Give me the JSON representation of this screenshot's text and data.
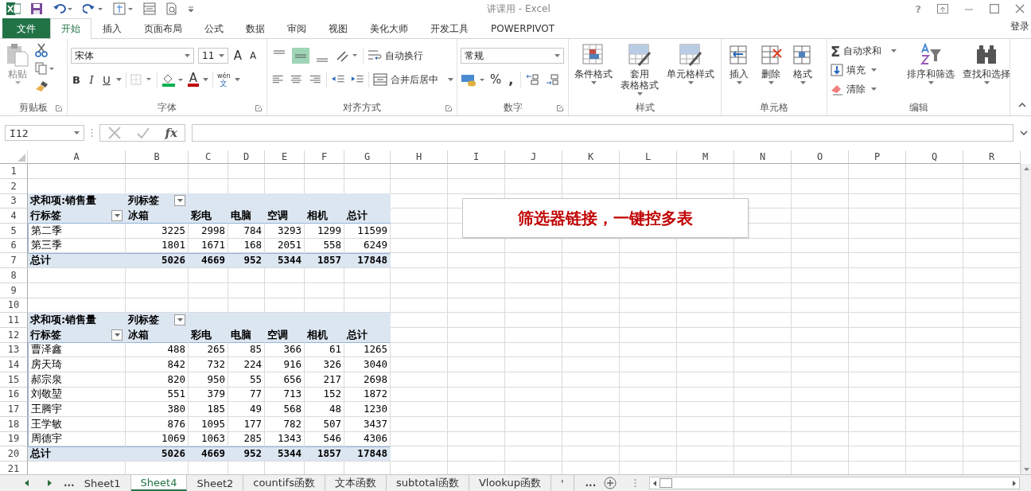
{
  "title_bar": {
    "title": "讲课用 - Excel",
    "help": "?"
  },
  "menu_tabs": [
    {
      "label": "文件",
      "kind": "file",
      "selected": false
    },
    {
      "label": "开始",
      "kind": "tab",
      "selected": true
    },
    {
      "label": "插入",
      "kind": "tab",
      "selected": false
    },
    {
      "label": "页面布局",
      "kind": "tab",
      "selected": false
    },
    {
      "label": "公式",
      "kind": "tab",
      "selected": false
    },
    {
      "label": "数据",
      "kind": "tab",
      "selected": false
    },
    {
      "label": "审阅",
      "kind": "tab",
      "selected": false
    },
    {
      "label": "视图",
      "kind": "tab",
      "selected": false
    },
    {
      "label": "美化大师",
      "kind": "tab",
      "selected": false
    },
    {
      "label": "开发工具",
      "kind": "tab",
      "selected": false
    },
    {
      "label": "POWERPIVOT",
      "kind": "tab",
      "selected": false
    }
  ],
  "sign_in": "登录",
  "ribbon": {
    "clipboard": {
      "label": "剪贴板",
      "paste": "粘贴"
    },
    "font": {
      "label": "字体",
      "family": "宋体",
      "size": "11",
      "grow": "A",
      "shrink": "A",
      "bold": "B",
      "italic": "I",
      "underline": "U",
      "font_color": "A",
      "phonetic_top": "wén",
      "phonetic_bottom": "文"
    },
    "alignment": {
      "label": "对齐方式",
      "vertical": [
        {
          "selected": false
        },
        {
          "selected": true
        },
        {
          "selected": false
        }
      ],
      "wrap": "自动换行",
      "merge": "合并后居中"
    },
    "number": {
      "label": "数字",
      "format": "常规",
      "percent": "%",
      "comma": ","
    },
    "styles": {
      "label": "样式",
      "buttons": [
        {
          "lines": [
            "条件格式"
          ]
        },
        {
          "lines": [
            "套用",
            "表格格式"
          ]
        },
        {
          "lines": [
            "单元格样式"
          ]
        }
      ]
    },
    "cells": {
      "label": "单元格",
      "buttons": [
        "插入",
        "删除",
        "格式"
      ]
    },
    "editing": {
      "label": "编辑",
      "sum_symbol": "Σ",
      "small": [
        "自动求和",
        "填充",
        "清除"
      ],
      "large": [
        "排序和筛选",
        "查找和选择"
      ]
    }
  },
  "formula_bar": {
    "name_box": "I12",
    "function_label": "fx"
  },
  "sheet": {
    "columns": [
      "A",
      "B",
      "C",
      "D",
      "E",
      "F",
      "G",
      "H",
      "I",
      "J",
      "K",
      "L",
      "M",
      "N",
      "O",
      "P",
      "Q",
      "R"
    ],
    "rows": [
      {
        "number": "1",
        "kind": "blank"
      },
      {
        "number": "2",
        "kind": "blank"
      },
      {
        "number": "3",
        "kind": "pivot-head",
        "cells": [
          "求和项:销售量",
          "列标签"
        ]
      },
      {
        "number": "4",
        "kind": "pivot-cols",
        "cells": [
          "行标签",
          "冰箱",
          "彩电",
          "电脑",
          "空调",
          "相机",
          "总计"
        ]
      },
      {
        "number": "5",
        "kind": "data",
        "cells": [
          "第二季",
          "3225",
          "2998",
          "784",
          "3293",
          "1299",
          "11599"
        ]
      },
      {
        "number": "6",
        "kind": "data",
        "cells": [
          "第三季",
          "1801",
          "1671",
          "168",
          "2051",
          "558",
          "6249"
        ]
      },
      {
        "number": "7",
        "kind": "total",
        "cells": [
          "总计",
          "5026",
          "4669",
          "952",
          "5344",
          "1857",
          "17848"
        ]
      },
      {
        "number": "8",
        "kind": "blank"
      },
      {
        "number": "9",
        "kind": "blank"
      },
      {
        "number": "10",
        "kind": "blank"
      },
      {
        "number": "11",
        "kind": "pivot-head",
        "cells": [
          "求和项:销售量",
          "列标签"
        ]
      },
      {
        "number": "12",
        "kind": "pivot-cols",
        "cells": [
          "行标签",
          "冰箱",
          "彩电",
          "电脑",
          "空调",
          "相机",
          "总计"
        ]
      },
      {
        "number": "13",
        "kind": "data",
        "cells": [
          "曹泽鑫",
          "488",
          "265",
          "85",
          "366",
          "61",
          "1265"
        ]
      },
      {
        "number": "14",
        "kind": "data",
        "cells": [
          "房天琦",
          "842",
          "732",
          "224",
          "916",
          "326",
          "3040"
        ]
      },
      {
        "number": "15",
        "kind": "data",
        "cells": [
          "郝宗泉",
          "820",
          "950",
          "55",
          "656",
          "217",
          "2698"
        ]
      },
      {
        "number": "16",
        "kind": "data",
        "cells": [
          "刘敬堃",
          "551",
          "379",
          "77",
          "713",
          "152",
          "1872"
        ]
      },
      {
        "number": "17",
        "kind": "data",
        "cells": [
          "王腾宇",
          "380",
          "185",
          "49",
          "568",
          "48",
          "1230"
        ]
      },
      {
        "number": "18",
        "kind": "data",
        "cells": [
          "王学敏",
          "876",
          "1095",
          "177",
          "782",
          "507",
          "3437"
        ]
      },
      {
        "number": "19",
        "kind": "data",
        "cells": [
          "周德宇",
          "1069",
          "1063",
          "285",
          "1343",
          "546",
          "4306"
        ]
      },
      {
        "number": "20",
        "kind": "total",
        "cells": [
          "总计",
          "5026",
          "4669",
          "952",
          "5344",
          "1857",
          "17848"
        ]
      },
      {
        "number": "21",
        "kind": "blank"
      }
    ]
  },
  "text_box": "筛选器链接，一键控多表",
  "sheet_tabs": {
    "left_more": "...",
    "tabs": [
      {
        "label": "Sheet1",
        "selected": false
      },
      {
        "label": "Sheet4",
        "selected": true
      },
      {
        "label": "Sheet2",
        "selected": false
      },
      {
        "label": "countifs函数",
        "selected": false
      },
      {
        "label": "文本函数",
        "selected": false
      },
      {
        "label": "subtotal函数",
        "selected": false
      },
      {
        "label": "Vlookup函数",
        "selected": false
      },
      {
        "label": "'",
        "selected": false
      }
    ],
    "right_more": "..."
  }
}
